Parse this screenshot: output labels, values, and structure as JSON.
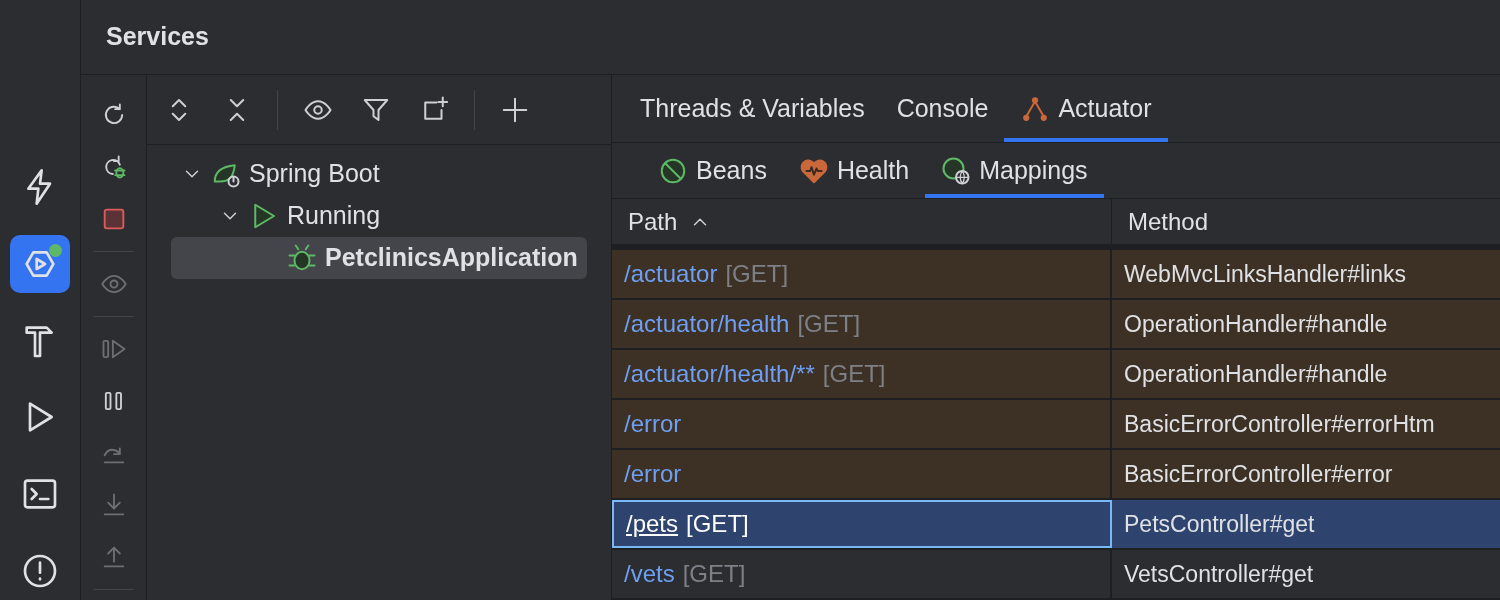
{
  "window": {
    "title": "Services"
  },
  "side_strip": [
    {
      "kind": "bolt",
      "selected": false
    },
    {
      "kind": "services",
      "selected": true
    },
    {
      "kind": "hammer",
      "selected": false
    },
    {
      "kind": "run",
      "selected": false
    },
    {
      "kind": "terminal",
      "selected": false
    },
    {
      "kind": "problems",
      "selected": false
    }
  ],
  "actions": [
    {
      "kind": "rerun",
      "disabled": false
    },
    {
      "kind": "rerun-debug",
      "disabled": false
    },
    {
      "kind": "stop",
      "disabled": false
    },
    {
      "kind": "sep"
    },
    {
      "kind": "eye",
      "disabled": true
    },
    {
      "kind": "sep"
    },
    {
      "kind": "resume",
      "disabled": true
    },
    {
      "kind": "pause",
      "disabled": false
    },
    {
      "kind": "step-over",
      "disabled": true
    },
    {
      "kind": "step-into",
      "disabled": true
    },
    {
      "kind": "step-out",
      "disabled": true
    },
    {
      "kind": "sep"
    }
  ],
  "tree_toolbar": [
    {
      "kind": "expand"
    },
    {
      "kind": "collapse"
    },
    {
      "kind": "sep"
    },
    {
      "kind": "eye"
    },
    {
      "kind": "filter"
    },
    {
      "kind": "new-tab"
    },
    {
      "kind": "sep"
    },
    {
      "kind": "add"
    }
  ],
  "tree": [
    {
      "label": "Spring Boot",
      "kind": "spring",
      "expanded": true,
      "selected": false,
      "children": [
        {
          "label": "Running",
          "kind": "running",
          "expanded": true,
          "selected": false,
          "children": [
            {
              "label": "PetclinicsApplication",
              "kind": "debug",
              "selected": true
            }
          ]
        }
      ]
    }
  ],
  "tabs": [
    {
      "label": "Threads & Variables",
      "selected": false
    },
    {
      "label": "Console",
      "selected": false
    },
    {
      "label": "Actuator",
      "kind": "actuator",
      "selected": true
    }
  ],
  "subtabs": [
    {
      "label": "Beans",
      "kind": "beans",
      "selected": false
    },
    {
      "label": "Health",
      "kind": "health",
      "selected": false
    },
    {
      "label": "Mappings",
      "kind": "mappings",
      "selected": true
    }
  ],
  "table": {
    "columns": [
      {
        "label": "Path",
        "sorted": true
      },
      {
        "label": "Method"
      }
    ],
    "rows": [
      {
        "path": "/actuator",
        "verb": "[GET]",
        "method": "WebMvcLinksHandler#links",
        "highlighted": true,
        "selected": false
      },
      {
        "path": "/actuator/health",
        "verb": "[GET]",
        "method": "OperationHandler#handle",
        "highlighted": true,
        "selected": false
      },
      {
        "path": "/actuator/health/**",
        "verb": "[GET]",
        "method": "OperationHandler#handle",
        "highlighted": true,
        "selected": false
      },
      {
        "path": "/error",
        "method": "BasicErrorController#errorHtm",
        "highlighted": true,
        "selected": false
      },
      {
        "path": "/error",
        "method": "BasicErrorController#error",
        "highlighted": true,
        "selected": false
      },
      {
        "path": "/pets",
        "verb": "[GET]",
        "method": "PetsController#get",
        "selected": true
      },
      {
        "path": "/vets",
        "verb": "[GET]",
        "method": "VetsController#get",
        "highlighted": false,
        "selected": false
      }
    ]
  }
}
